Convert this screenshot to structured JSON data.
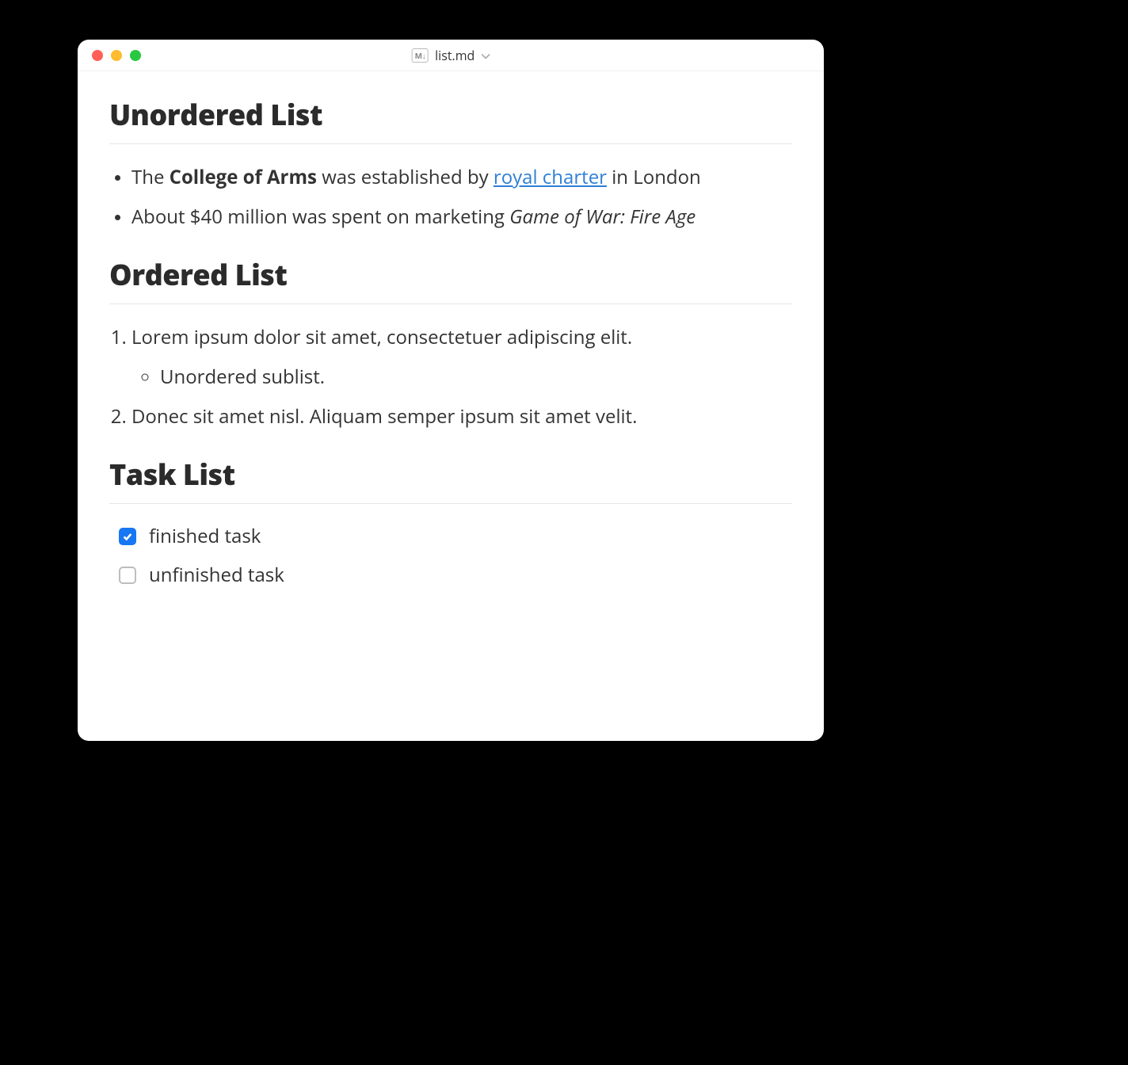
{
  "window": {
    "filename": "list.md"
  },
  "sections": {
    "unordered": {
      "heading": "Unordered List",
      "items": [
        {
          "pre": "The ",
          "bold": "College of Arms",
          "mid": " was established by ",
          "link": "royal charter",
          "post": " in London"
        },
        {
          "pre": "About $40 million was spent on marketing ",
          "italic": "Game of War: Fire Age"
        }
      ]
    },
    "ordered": {
      "heading": "Ordered List",
      "items": [
        {
          "text": "Lorem ipsum dolor sit amet, consectetuer adipiscing elit.",
          "sub": "Unordered sublist."
        },
        {
          "text": "Donec sit amet nisl. Aliquam semper ipsum sit amet velit."
        }
      ]
    },
    "tasks": {
      "heading": "Task List",
      "items": [
        {
          "checked": true,
          "label": "finished task"
        },
        {
          "checked": false,
          "label": "unfinished task"
        }
      ]
    }
  }
}
